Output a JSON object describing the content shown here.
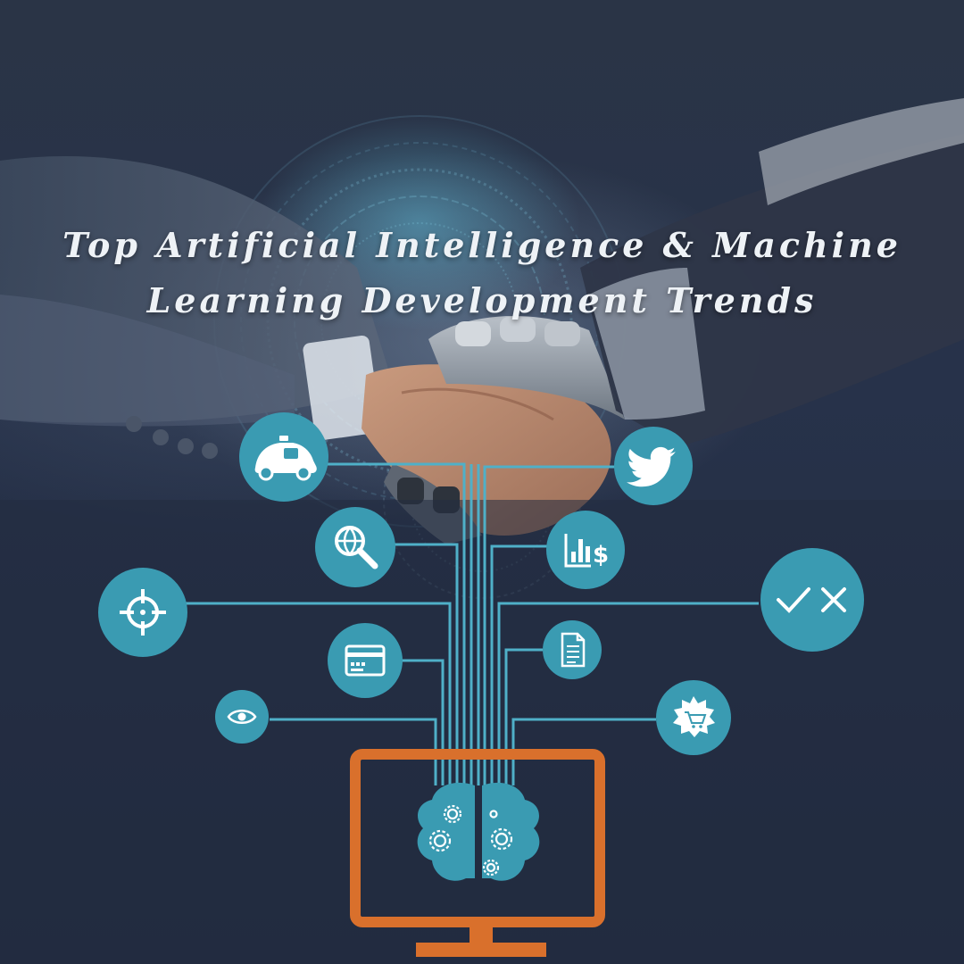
{
  "title": {
    "line1": "Top Artificial Intelligence & Machine",
    "line2": "Learning Development Trends"
  },
  "colors": {
    "background": "#222c40",
    "node_fill": "#3a9bb2",
    "connector": "#4fb0c8",
    "monitor": "#d9702c",
    "icon": "#ffffff"
  },
  "icons": [
    "self-driving-car-icon",
    "twitter-bird-icon",
    "global-search-icon",
    "finance-chart-icon",
    "target-crosshair-icon",
    "check-cross-icon",
    "credit-card-icon",
    "document-icon",
    "eye-icon",
    "shopping-badge-icon",
    "monitor-icon",
    "brain-gears-icon"
  ]
}
